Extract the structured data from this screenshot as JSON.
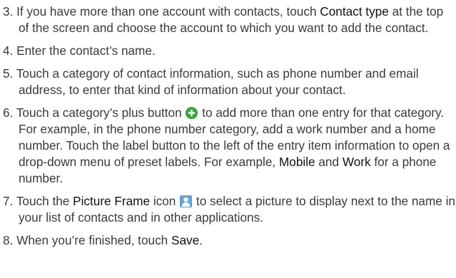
{
  "steps": [
    {
      "num": "3.",
      "parts": [
        "If you have more than one account with contacts, touch ",
        "Contact type",
        " at the top of the screen and choose the account to which you want to add the contact."
      ]
    },
    {
      "num": "4.",
      "parts": [
        "Enter the contact’s name."
      ]
    },
    {
      "num": "5.",
      "parts": [
        "Touch a category of contact information, such as phone number and email address, to enter that kind of information about your contact."
      ]
    },
    {
      "num": "6.",
      "parts": [
        "Touch a category’s plus button ",
        " to add more than one entry for that category. For example, in the phone number category, add a work number and a home number. Touch the label button to the left of the entry item information to open a drop-down menu of preset labels. For example, ",
        "Mobile",
        " and ",
        "Work",
        " for a phone number."
      ]
    },
    {
      "num": "7.",
      "parts": [
        "Touch the ",
        "Picture Frame",
        " icon ",
        " to select a picture to display next to the name in your list of contacts and in other applications."
      ]
    },
    {
      "num": "8.",
      "parts": [
        "When you’re finished, touch ",
        "Save",
        "."
      ]
    }
  ],
  "icons": {
    "plus_button": "plus-circle-icon",
    "picture_frame": "picture-frame-icon"
  },
  "colors": {
    "text": "#3a3a3a",
    "plus_icon": "#3aa83a",
    "picture_icon": "#6aa8d8"
  }
}
